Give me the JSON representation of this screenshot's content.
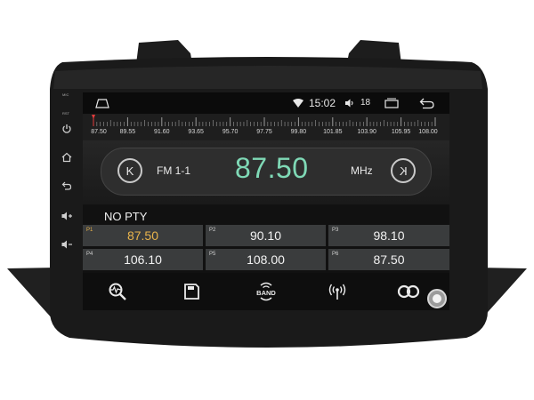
{
  "statusbar": {
    "time": "15:02",
    "volume": "18"
  },
  "side_buttons": {
    "mic": "MIC",
    "rst": "RST"
  },
  "scale": {
    "labels": [
      "87.50",
      "89.55",
      "91.60",
      "93.65",
      "95.70",
      "97.75",
      "99.80",
      "101.85",
      "103.90",
      "105.95",
      "108.00"
    ],
    "indicator_color": "#e23b3b"
  },
  "tuner": {
    "prev_symbol": "K",
    "next_symbol": "K",
    "band": "FM 1-1",
    "frequency": "87.50",
    "unit": "MHz"
  },
  "pty": "NO PTY",
  "presets": [
    {
      "num": "P1",
      "value": "87.50",
      "active": true
    },
    {
      "num": "P2",
      "value": "90.10",
      "active": false
    },
    {
      "num": "P3",
      "value": "98.10",
      "active": false
    },
    {
      "num": "P4",
      "value": "106.10",
      "active": false
    },
    {
      "num": "P5",
      "value": "108.00",
      "active": false
    },
    {
      "num": "P6",
      "value": "87.50",
      "active": false
    }
  ],
  "toolbar": {
    "band_label": "BAND",
    "icons": [
      "search-scan-icon",
      "save-icon",
      "band-icon",
      "antenna-icon",
      "stereo-icon"
    ]
  },
  "colors": {
    "frequency": "#7fd9b6",
    "active_preset": "#e9b44c"
  }
}
